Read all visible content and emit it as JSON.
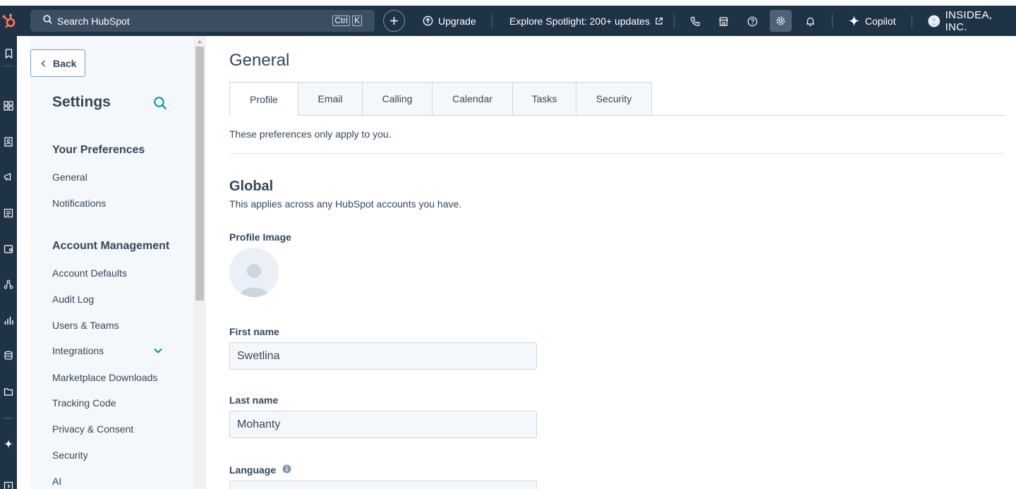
{
  "topbar": {
    "search_placeholder": "Search HubSpot",
    "shortcut_key1": "Ctrl",
    "shortcut_key2": "K",
    "upgrade_label": "Upgrade",
    "spotlight_label": "Explore Spotlight: 200+ updates",
    "copilot_label": "Copilot",
    "account_label": "INSIDEA, INC."
  },
  "sidebar": {
    "back_label": "Back",
    "title": "Settings",
    "sections": [
      {
        "heading": "Your Preferences",
        "items": [
          "General",
          "Notifications"
        ]
      },
      {
        "heading": "Account Management",
        "items": [
          "Account Defaults",
          "Audit Log",
          "Users & Teams",
          "Integrations",
          "Marketplace Downloads",
          "Tracking Code",
          "Privacy & Consent",
          "Security",
          "AI"
        ]
      }
    ]
  },
  "main": {
    "title": "General",
    "tabs": [
      "Profile",
      "Email",
      "Calling",
      "Calendar",
      "Tasks",
      "Security"
    ],
    "intro": "These preferences only apply to you.",
    "section_title": "Global",
    "section_subtitle": "This applies across any HubSpot accounts you have.",
    "profile_image_label": "Profile Image",
    "first_name_label": "First name",
    "first_name_value": "Swetlina",
    "last_name_label": "Last name",
    "last_name_value": "Mohanty",
    "language_label": "Language"
  },
  "icons": {
    "rail": [
      "bookmark-icon",
      "apps-icon",
      "contacts-icon",
      "marketing-icon",
      "content-icon",
      "commerce-icon",
      "automation-icon",
      "reporting-icon",
      "data-icon",
      "library-icon",
      "sparkle-icon",
      "expand-icon"
    ]
  },
  "colors": {
    "nav_bg": "#1f3347",
    "accent_orange": "#ff7a59",
    "link_teal": "#0091ae"
  }
}
